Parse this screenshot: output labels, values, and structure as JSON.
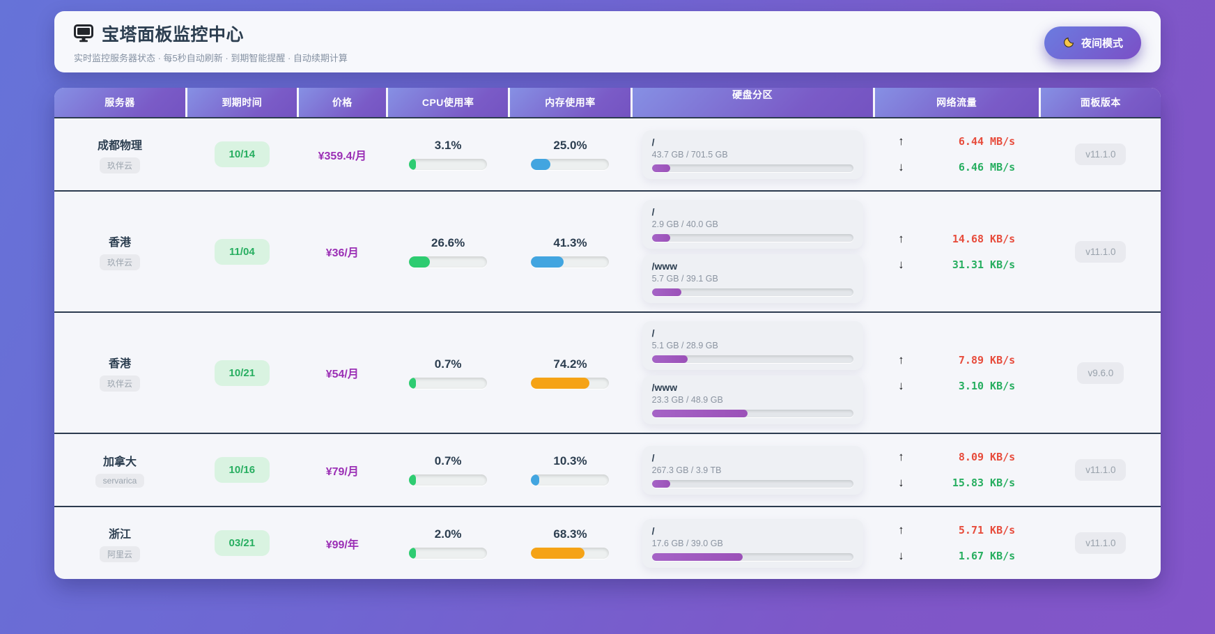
{
  "header": {
    "title": "宝塔面板监控中心",
    "subtitle": "实时监控服务器状态 · 每5秒自动刷新 · 到期智能提醒 · 自动续期计算",
    "night_mode_label": "夜间模式"
  },
  "icons": {
    "monitor": "monitor-display",
    "moon": "crescent-moon",
    "upload": "↑",
    "download": "↓"
  },
  "colors": {
    "cpu_bar": "#2ecc71",
    "mem_bar_normal": "#42a5e0",
    "mem_bar_high": "#f5a316",
    "disk_bar": "#9b51b8",
    "price_text": "#9b2fb5",
    "expiry_badge_bg": "#d9f3e1",
    "expiry_badge_text": "#27ae60",
    "net_up": "#e74c3c",
    "net_down": "#27ae60"
  },
  "table": {
    "columns": [
      "服务器",
      "到期时间",
      "价格",
      "CPU使用率",
      "内存使用率",
      "硬盘分区",
      "网络流量",
      "面板版本"
    ],
    "rows": [
      {
        "name": "成都物理",
        "provider": "玖伴云",
        "expiry": "10/14",
        "price": "¥359.4/月",
        "cpu": {
          "label": "3.1%",
          "pct": 3.1,
          "color": "#2ecc71"
        },
        "mem": {
          "label": "25.0%",
          "pct": 25.0,
          "color": "#42a5e0"
        },
        "disks": [
          {
            "name": "/",
            "usage": "43.7 GB / 701.5 GB",
            "pct": 6.2
          }
        ],
        "net": {
          "up": "6.44 MB/s",
          "down": "6.46 MB/s"
        },
        "version": "v11.1.0"
      },
      {
        "name": "香港",
        "provider": "玖伴云",
        "expiry": "11/04",
        "price": "¥36/月",
        "cpu": {
          "label": "26.6%",
          "pct": 26.6,
          "color": "#2ecc71"
        },
        "mem": {
          "label": "41.3%",
          "pct": 41.3,
          "color": "#42a5e0"
        },
        "disks": [
          {
            "name": "/",
            "usage": "2.9 GB / 40.0 GB",
            "pct": 7.3
          },
          {
            "name": "/www",
            "usage": "5.7 GB / 39.1 GB",
            "pct": 14.6
          }
        ],
        "net": {
          "up": "14.68 KB/s",
          "down": "31.31 KB/s"
        },
        "version": "v11.1.0"
      },
      {
        "name": "香港",
        "provider": "玖伴云",
        "expiry": "10/21",
        "price": "¥54/月",
        "cpu": {
          "label": "0.7%",
          "pct": 0.7,
          "color": "#2ecc71"
        },
        "mem": {
          "label": "74.2%",
          "pct": 74.2,
          "color": "#f5a316"
        },
        "disks": [
          {
            "name": "/",
            "usage": "5.1 GB / 28.9 GB",
            "pct": 17.6
          },
          {
            "name": "/www",
            "usage": "23.3 GB / 48.9 GB",
            "pct": 47.6
          }
        ],
        "net": {
          "up": "7.89 KB/s",
          "down": "3.10 KB/s"
        },
        "version": "v9.6.0"
      },
      {
        "name": "加拿大",
        "provider": "servarica",
        "expiry": "10/16",
        "price": "¥79/月",
        "cpu": {
          "label": "0.7%",
          "pct": 0.7,
          "color": "#2ecc71"
        },
        "mem": {
          "label": "10.3%",
          "pct": 10.3,
          "color": "#42a5e0"
        },
        "disks": [
          {
            "name": "/",
            "usage": "267.3 GB / 3.9 TB",
            "pct": 6.7
          }
        ],
        "net": {
          "up": "8.09 KB/s",
          "down": "15.83 KB/s"
        },
        "version": "v11.1.0"
      },
      {
        "name": "浙江",
        "provider": "阿里云",
        "expiry": "03/21",
        "price": "¥99/年",
        "cpu": {
          "label": "2.0%",
          "pct": 2.0,
          "color": "#2ecc71"
        },
        "mem": {
          "label": "68.3%",
          "pct": 68.3,
          "color": "#f5a316"
        },
        "disks": [
          {
            "name": "/",
            "usage": "17.6 GB / 39.0 GB",
            "pct": 45.1
          }
        ],
        "net": {
          "up": "5.71 KB/s",
          "down": "1.67 KB/s"
        },
        "version": "v11.1.0"
      }
    ]
  }
}
